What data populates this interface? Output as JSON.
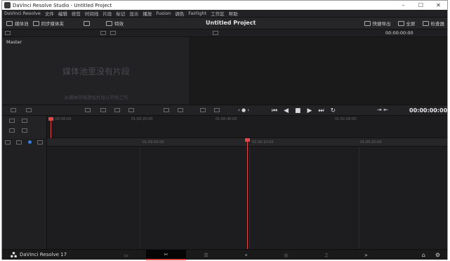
{
  "window": {
    "title": "DaVinci Resolve Studio - Untitled Project",
    "controls": [
      "–",
      "☐",
      "✕"
    ]
  },
  "menu": [
    "DaVinci Resolve",
    "文件",
    "编辑",
    "修剪",
    "时间线",
    "片段",
    "标记",
    "显示",
    "播放",
    "Fusion",
    "调色",
    "Fairlight",
    "工作区",
    "帮助"
  ],
  "toolbar": {
    "media_pool": "媒体池",
    "sync_bin": "同步媒体夹",
    "effects": "特效",
    "project_title": "Untitled Project",
    "quick_export": "快捷导出",
    "fullscreen": "全屏",
    "inspector": "检查器"
  },
  "subbar": {
    "timecode": "00:00:00:00"
  },
  "media_pool": {
    "bin": "Master",
    "empty_title": "媒体池里没有片段",
    "empty_hint": "从媒体存储添加片段以开始工作"
  },
  "viewer": {
    "timecode": "00:00:00:00"
  },
  "ruler_upper": [
    "01:00:00:00",
    "01:00:20:00",
    "01:00:40:00",
    "01:01:00:00"
  ],
  "ruler_lower": [
    "01:00:00:00",
    "01:00:10:00",
    "01:00:20:00"
  ],
  "bottom": {
    "brand": "DaVinci Resolve 17",
    "pages": [
      "媒体",
      "快编",
      "剪辑",
      "Fusion",
      "调色",
      "Fairlight",
      "交付"
    ],
    "active_page": 1
  },
  "colors": {
    "accent": "#e04848",
    "background": "#1c1c1e"
  }
}
